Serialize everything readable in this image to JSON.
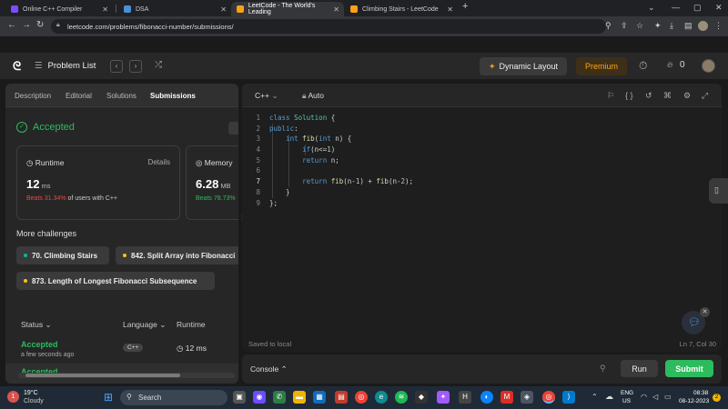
{
  "browser": {
    "tabs": [
      {
        "title": "Online C++ Compiler",
        "color": "#7c4dff"
      },
      {
        "title": "DSA",
        "color": "#4a90d9"
      },
      {
        "title": "LeetCode - The World's Leading",
        "color": "#ffa116"
      },
      {
        "title": "Climbing Stairs - LeetCode",
        "color": "#ffa116"
      }
    ],
    "new_tab": "+",
    "url": "leetcode.com/problems/fibonacci-number/submissions/"
  },
  "header": {
    "problem_list": "Problem List",
    "dynamic_layout": "Dynamic Layout",
    "premium": "Premium",
    "streak": "0"
  },
  "left": {
    "tabs": [
      "Description",
      "Editorial",
      "Solutions",
      "Submissions"
    ],
    "accepted": "Accepted",
    "runtime": {
      "label": "Runtime",
      "details": "Details",
      "value": "12",
      "unit": "ms",
      "beats_pct": "Beats 31.34%",
      "beats_rest": "of users with C++"
    },
    "memory": {
      "label": "Memory",
      "value": "6.28",
      "unit": "MB",
      "beats_pct": "Beats 78.73%"
    },
    "more_challenges": "More challenges",
    "challenges": [
      "70. Climbing Stairs",
      "842. Split Array into Fibonacci",
      "873. Length of Longest Fibonacci Subsequence"
    ],
    "table_headers": {
      "status": "Status",
      "language": "Language",
      "runtime": "Runtime"
    },
    "rows": [
      {
        "status": "Accepted",
        "time": "a few seconds ago",
        "lang": "C++",
        "runtime": "12 ms"
      },
      {
        "status": "Accepted"
      }
    ]
  },
  "editor": {
    "language": "C++",
    "mode": "Auto",
    "lines": [
      "1",
      "2",
      "3",
      "4",
      "5",
      "6",
      "7",
      "8",
      "9"
    ],
    "saved": "Saved to local",
    "position": "Ln 7, Col 30"
  },
  "console": {
    "label": "Console",
    "run": "Run",
    "submit": "Submit"
  },
  "taskbar": {
    "temp": "19°C",
    "weather": "Cloudy",
    "search": "Search",
    "lang": "ENG",
    "region": "US",
    "time": "08:38",
    "date": "08-12-2023"
  }
}
